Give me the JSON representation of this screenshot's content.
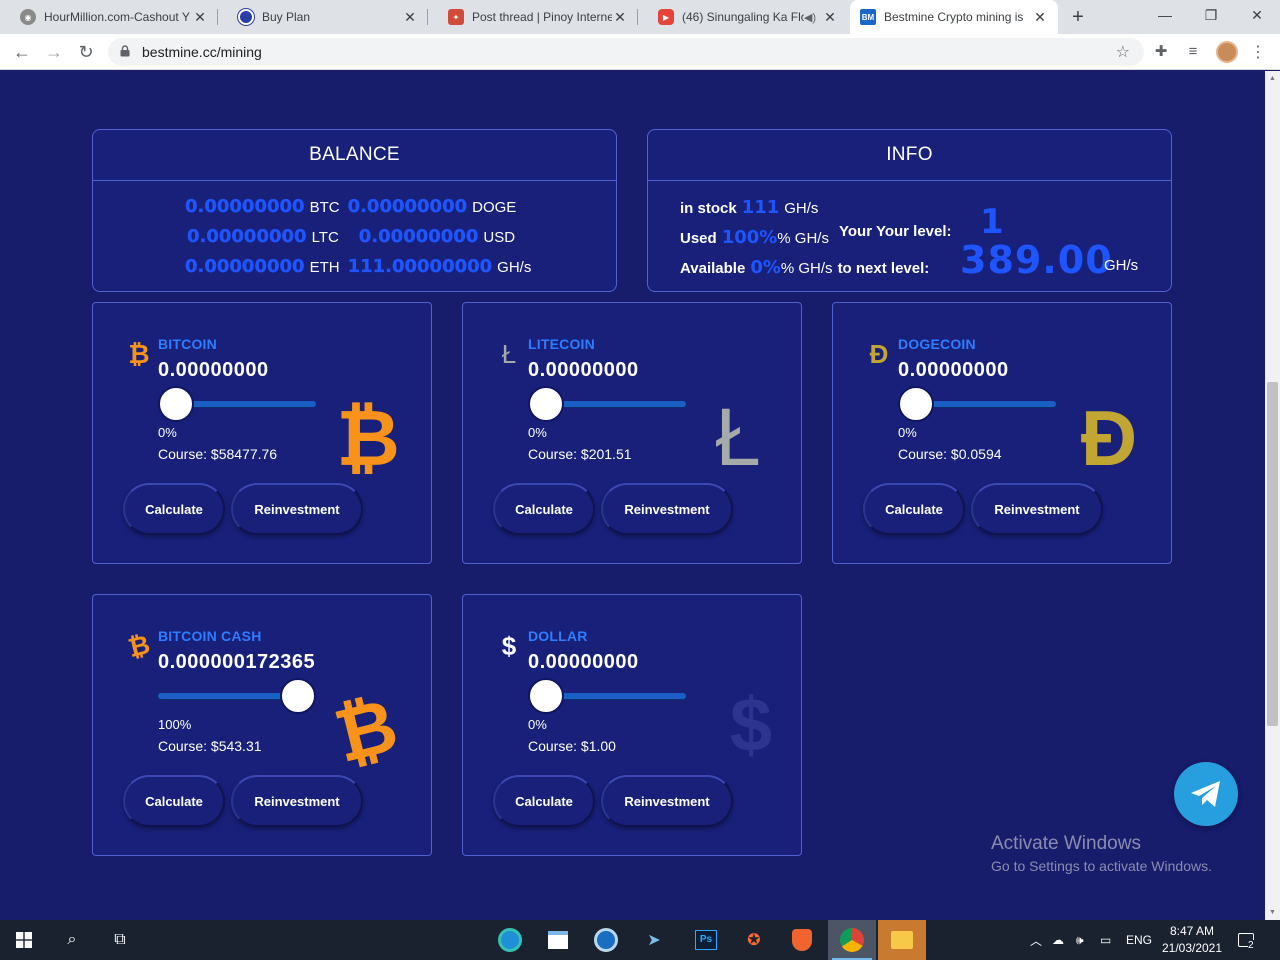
{
  "browser": {
    "tabs": [
      {
        "title": "HourMillion.com-Cashout Y",
        "icon": "globe-favicon",
        "color": "#8a8a8a"
      },
      {
        "title": "Buy Plan",
        "icon": "circle-favicon",
        "color": "#2b3fa3"
      },
      {
        "title": "Post thread | Pinoy Internet",
        "icon": "pinoy-favicon",
        "color": "#d04b3a"
      },
      {
        "title": "(46) Sinungaling Ka Flo",
        "icon": "youtube-favicon",
        "color": "#e5443a"
      },
      {
        "title": "Bestmine Crypto mining is",
        "icon": "bm-favicon",
        "color": "#1b66c9",
        "active": true
      }
    ],
    "url": "bestmine.cc/mining",
    "favicon_text": "BM"
  },
  "balance": {
    "title": "BALANCE",
    "rows": [
      [
        {
          "value": "0.00000000",
          "unit": "BTC"
        },
        {
          "value": "0.00000000",
          "unit": "DOGE"
        }
      ],
      [
        {
          "value": "0.00000000",
          "unit": "LTC"
        },
        {
          "value": "0.00000000",
          "unit": "USD"
        }
      ],
      [
        {
          "value": "0.00000000",
          "unit": "ETH"
        },
        {
          "value": "111.00000000",
          "unit": "GH/s"
        }
      ]
    ]
  },
  "info": {
    "title": "INFO",
    "in_stock_label": "in stock",
    "in_stock_value": "111",
    "in_stock_unit": "GH/s",
    "used_label": "Used",
    "used_value": "100%",
    "used_unit": "% GH/s",
    "available_label": "Available",
    "available_value": "0%",
    "available_unit": "% GH/s",
    "level_label": "Your Your level:",
    "level_value": "1",
    "next_level_label": "to next level:",
    "next_level_value": "389.00",
    "next_level_unit": "GH/s"
  },
  "coins": [
    {
      "name": "BITCOIN",
      "amount": "0.00000000",
      "percent_label": "0%",
      "percent": 0,
      "course": "Course: $58477.76",
      "icon": "bitcoin-icon",
      "glyph": "₿",
      "color": "#f7931a"
    },
    {
      "name": "LITECOIN",
      "amount": "0.00000000",
      "percent_label": "0%",
      "percent": 0,
      "course": "Course: $201.51",
      "icon": "litecoin-icon",
      "glyph": "Ł",
      "color": "#a6a9aa"
    },
    {
      "name": "DOGECOIN",
      "amount": "0.00000000",
      "percent_label": "0%",
      "percent": 0,
      "course": "Course: $0.0594",
      "icon": "dogecoin-icon",
      "glyph": "Ð",
      "color": "#c2a633"
    },
    {
      "name": "BITCOIN CASH",
      "amount": "0.000000172365",
      "percent_label": "100%",
      "percent": 100,
      "course": "Course: $543.31",
      "icon": "bitcoin-cash-icon",
      "glyph": "₿",
      "color": "#f7931a"
    },
    {
      "name": "DOLLAR",
      "amount": "0.00000000",
      "percent_label": "0%",
      "percent": 0,
      "course": "Course: $1.00",
      "icon": "dollar-icon",
      "glyph": "$",
      "color": "#ffffff"
    }
  ],
  "buttons": {
    "calculate": "Calculate",
    "reinvestment": "Reinvestment"
  },
  "watermark": {
    "line1": "Activate Windows",
    "line2": "Go to Settings to activate Windows."
  },
  "taskbar": {
    "language": "ENG",
    "time": "8:47 AM",
    "date": "21/03/2021",
    "notifications": "2"
  }
}
